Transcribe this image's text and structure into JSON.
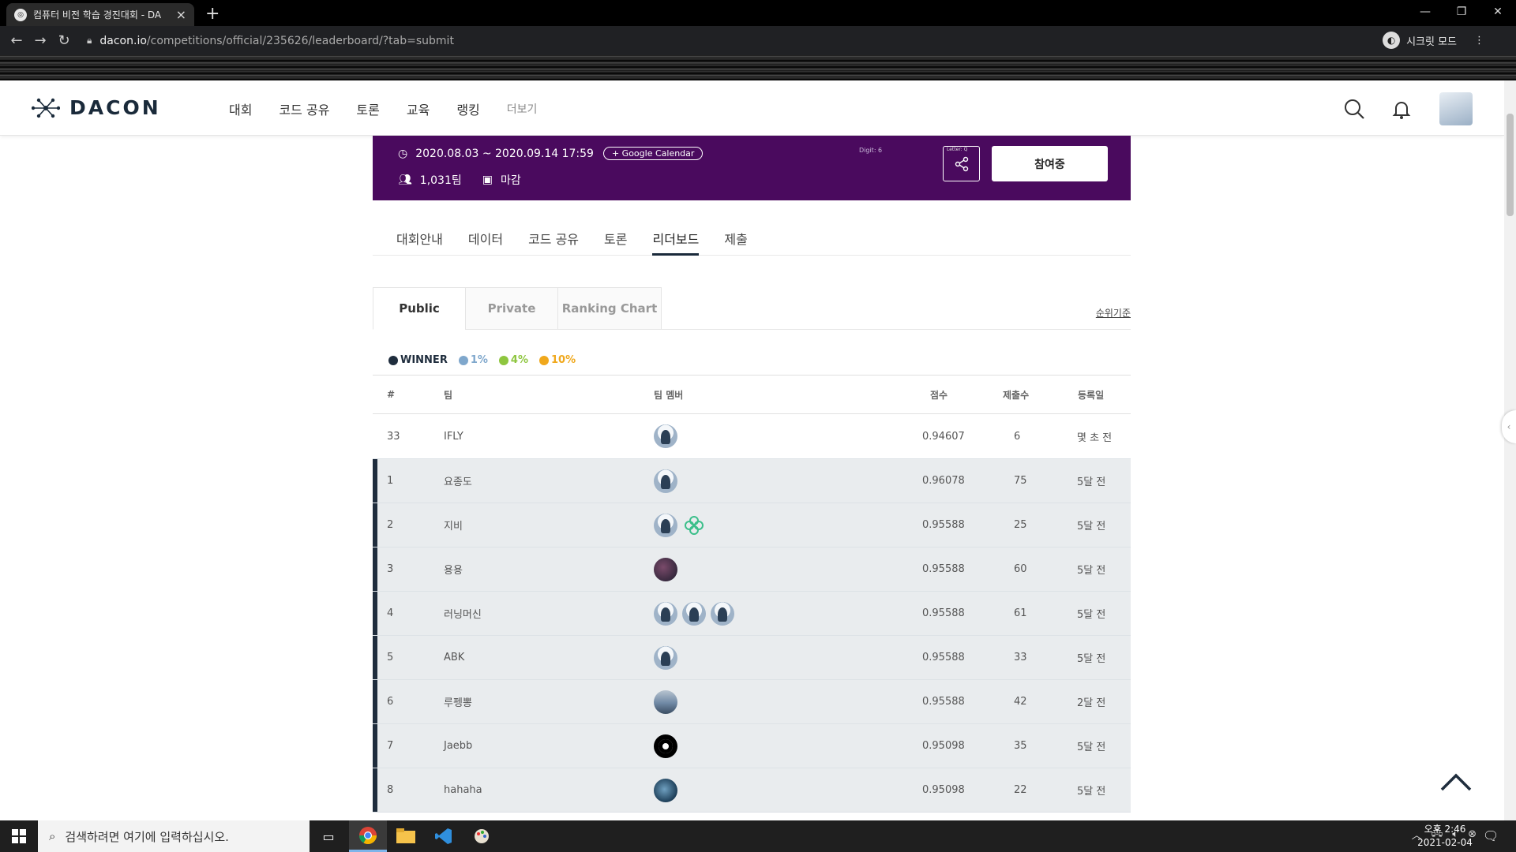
{
  "browser": {
    "tab_title": "컴퓨터 비전 학습 경진대회 - DA",
    "url_host": "dacon.io",
    "url_path": "/competitions/official/235626/leaderboard/?tab=submit",
    "incognito_label": "시크릿 모드"
  },
  "site": {
    "logo_text": "DACON",
    "nav": [
      "대회",
      "코드 공유",
      "토론",
      "교육",
      "랭킹"
    ],
    "nav_more": "더보기"
  },
  "banner": {
    "period": "2020.08.03 ~ 2020.09.14 17:59",
    "gcal_label": "+ Google Calendar",
    "teams": "1,031팀",
    "status": "마감",
    "digit_caption": "Digit: 6",
    "letter_caption": "Letter: Q",
    "join_label": "참여중"
  },
  "subtabs": [
    "대회안내",
    "데이터",
    "코드 공유",
    "토론",
    "리더보드",
    "제출"
  ],
  "board": {
    "tabs": [
      "Public",
      "Private",
      "Ranking Chart"
    ],
    "rank_criteria": "순위기준"
  },
  "legend": [
    {
      "label": "WINNER",
      "color": "#1f2d3d"
    },
    {
      "label": "1%",
      "color": "#7fa7cc"
    },
    {
      "label": "4%",
      "color": "#8ec63f"
    },
    {
      "label": "10%",
      "color": "#f0a81c"
    }
  ],
  "table": {
    "headers": [
      "#",
      "팀",
      "팀 멤버",
      "점수",
      "제출수",
      "등록일"
    ],
    "my_row": {
      "rank": "33",
      "team": "IFLY",
      "members": [
        "default"
      ],
      "score": "0.94607",
      "subs": "6",
      "date": "몇 초 전"
    },
    "rows": [
      {
        "rank": "1",
        "team": "요종도",
        "members": [
          "default"
        ],
        "score": "0.96078",
        "subs": "75",
        "date": "5달 전"
      },
      {
        "rank": "2",
        "team": "지비",
        "members": [
          "default",
          "clover"
        ],
        "score": "0.95588",
        "subs": "25",
        "date": "5달 전"
      },
      {
        "rank": "3",
        "team": "용용",
        "members": [
          "dark"
        ],
        "score": "0.95588",
        "subs": "60",
        "date": "5달 전"
      },
      {
        "rank": "4",
        "team": "러닝머신",
        "members": [
          "default",
          "default",
          "default"
        ],
        "score": "0.95588",
        "subs": "61",
        "date": "5달 전"
      },
      {
        "rank": "5",
        "team": "ABK",
        "members": [
          "default"
        ],
        "score": "0.95588",
        "subs": "33",
        "date": "5달 전"
      },
      {
        "rank": "6",
        "team": "루펭뽕",
        "members": [
          "sky"
        ],
        "score": "0.95588",
        "subs": "42",
        "date": "2달 전"
      },
      {
        "rank": "7",
        "team": "Jaebb",
        "members": [
          "gh"
        ],
        "score": "0.95098",
        "subs": "35",
        "date": "5달 전"
      },
      {
        "rank": "8",
        "team": "hahaha",
        "members": [
          "world"
        ],
        "score": "0.95098",
        "subs": "22",
        "date": "5달 전"
      }
    ]
  },
  "taskbar": {
    "search_placeholder": "검색하려면 여기에 입력하십시오.",
    "time": "오후 2:46",
    "date": "2021-02-04"
  }
}
